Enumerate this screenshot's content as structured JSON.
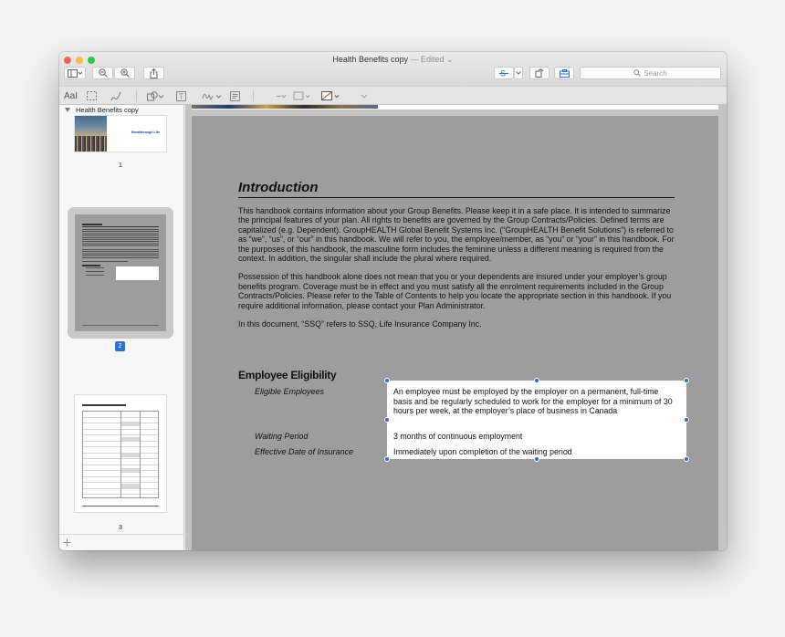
{
  "window": {
    "title": "Health Benefits copy",
    "edited": "— Edited",
    "edited_chevron": "⌄"
  },
  "toolbar": {
    "sidebar_icon": "sidebar-icon",
    "zoom_out_icon": "zoom-out-icon",
    "zoom_in_icon": "zoom-in-icon",
    "share_icon": "share-icon",
    "highlight_icon": "highlight-icon",
    "rotate_icon": "rotate-icon",
    "markup_icon": "toolbox-icon",
    "search_placeholder": "Search"
  },
  "markup": {
    "text_tool": "AaI"
  },
  "sidebar": {
    "title": "Health Benefits copy",
    "page1_label": "Breakthrough Life",
    "pages": [
      "1",
      "2",
      "3"
    ]
  },
  "document": {
    "heading": "Introduction",
    "para1": "This handbook contains information about your Group Benefits.  Please keep it in a safe place.  It is intended to summarize the principal features of your plan.  All rights to benefits are governed by the Group Contracts/Policies.  Defined terms are capitalized (e.g. Dependent).  GroupHEALTH Global Benefit Systems Inc. (“GroupHEALTH Benefit Solutions”) is referred to as “we”, “us”, or “our” in this handbook.  We will refer to you, the employee/member, as “you” or “your” in this handbook.  For the purposes of this handbook, the masculine form includes the feminine unless a different meaning is required from the context.  In addition, the singular shall include the plural where required.",
    "para2": "Possession of this handbook alone does not mean that you or your dependents are insured under your employer’s group benefits program.  Coverage must be in effect and you must satisfy all the enrolment requirements included in the Group Contracts/Policies.  Please refer to the Table of Contents to help you locate the appropriate section in this handbook.  If you require additional information, please contact your Plan Administrator.",
    "para3": "In this document, “SSQ” refers to SSQ, Life Insurance Company Inc.",
    "eligibility_heading": "Employee Eligibility",
    "rows": [
      {
        "label": "Eligible Employees",
        "value": "An employee must be employed by the employer on a permanent, full-time basis and be regularly scheduled to work for the employer for a minimum of 30 hours per week, at the employer’s place of business in Canada"
      },
      {
        "label": "Waiting Period",
        "value": "3 months of continuous employment"
      },
      {
        "label": "Effective Date of Insurance",
        "value": "Immediately upon completion of the waiting period"
      }
    ]
  },
  "colors": {
    "accent": "#2d6ed8",
    "page_bg": "#9d9d9d",
    "sidebar_selection": "#c9c9c9"
  }
}
